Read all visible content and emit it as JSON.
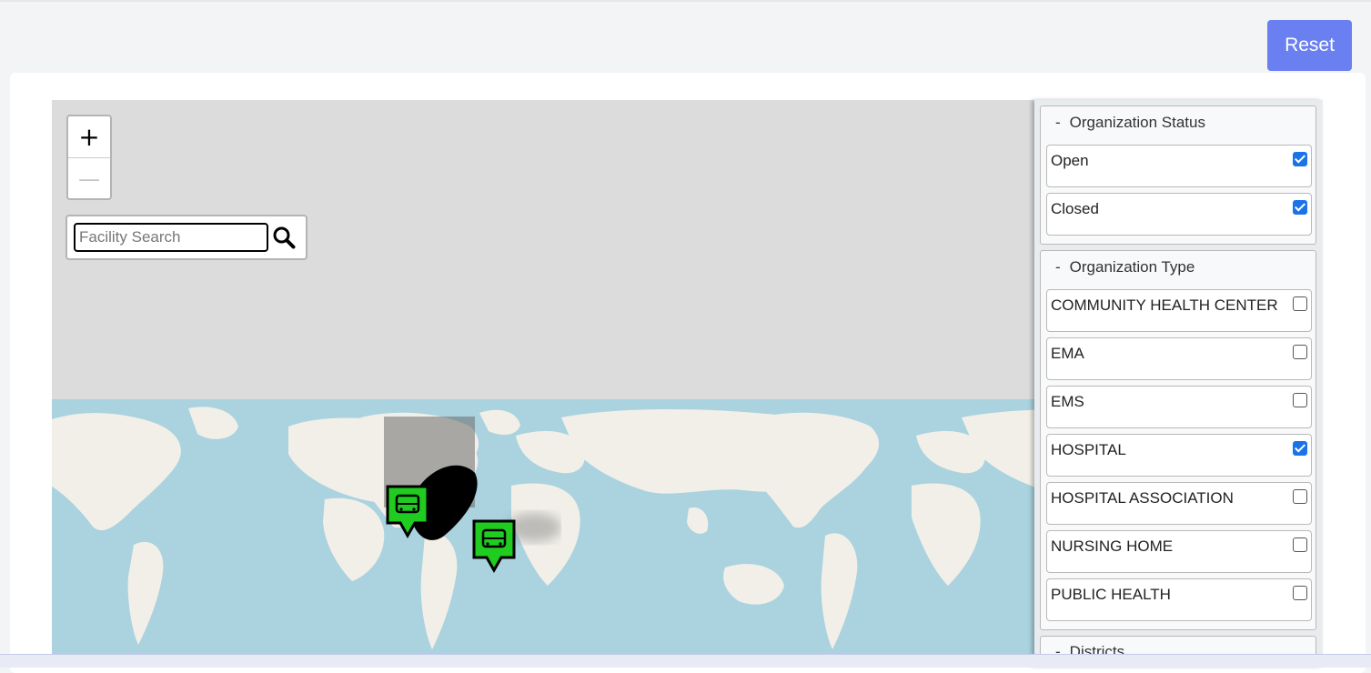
{
  "header": {
    "reset_label": "Reset"
  },
  "map": {
    "zoom_in_label": "+",
    "zoom_out_label": "—",
    "search": {
      "placeholder": "Facility Search"
    }
  },
  "filters": {
    "status": {
      "toggle": "-",
      "title": "Organization Status",
      "options": [
        {
          "label": "Open",
          "checked": true
        },
        {
          "label": "Closed",
          "checked": true
        }
      ]
    },
    "type": {
      "toggle": "-",
      "title": "Organization Type",
      "options": [
        {
          "label": "COMMUNITY HEALTH CENTER",
          "checked": false
        },
        {
          "label": "EMA",
          "checked": false
        },
        {
          "label": "EMS",
          "checked": false
        },
        {
          "label": "HOSPITAL",
          "checked": true
        },
        {
          "label": "HOSPITAL ASSOCIATION",
          "checked": false
        },
        {
          "label": "NURSING HOME",
          "checked": false
        },
        {
          "label": "PUBLIC HEALTH",
          "checked": false
        }
      ]
    },
    "districts": {
      "toggle": "-",
      "title": "Districts"
    }
  },
  "colors": {
    "accent": "#6a7ff0",
    "ocean": "#aad3df",
    "land": "#f2efe9",
    "marker": "#1fcc1f",
    "checkbox": "#1a73e8"
  }
}
